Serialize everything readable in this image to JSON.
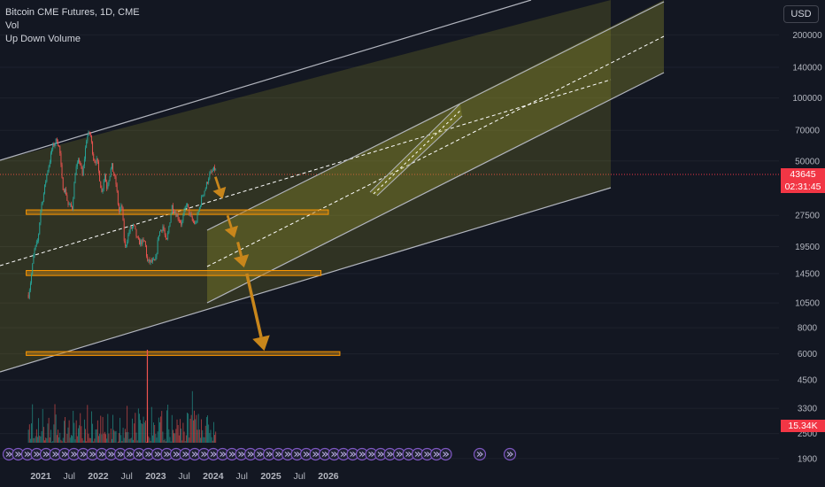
{
  "legend": {
    "symbol": "Bitcoin CME Futures, 1D, CME",
    "vol": "Vol",
    "indicator": "Up Down Volume"
  },
  "currency_button": "USD",
  "last_price": "43645",
  "countdown": "02:31:45",
  "volume_value": "15.34K",
  "colors": {
    "background": "#131722",
    "up": "#26a69a",
    "down": "#ef5350",
    "channel_fill": "#9c9c2a",
    "zone_fill": "#b57a1a",
    "zone_border": "#ff9800",
    "arrow": "#c8861b",
    "event_icon": "#7e57c2"
  },
  "chart_data": {
    "type": "candlestick",
    "title": "Bitcoin CME Futures, 1D, CME",
    "y_scale": "log",
    "y_ticks": [
      200000,
      140000,
      100000,
      70000,
      50000,
      27500,
      19500,
      14500,
      10500,
      8000,
      6000,
      4500,
      3300,
      2500,
      1900
    ],
    "y_tick_labels": [
      "200000",
      "140000",
      "100000",
      "70000",
      "50000",
      "27500",
      "19500",
      "14500",
      "10500",
      "8000",
      "6000",
      "4500",
      "3300",
      "2500",
      "1900"
    ],
    "x_ticks": [
      "2021",
      "Jul",
      "2022",
      "Jul",
      "2023",
      "Jul",
      "2024",
      "Jul",
      "2025",
      "Jul",
      "2026"
    ],
    "price_path": [
      [
        "2020-10-15",
        11500
      ],
      [
        "2020-11-01",
        13800
      ],
      [
        "2020-11-20",
        18500
      ],
      [
        "2020-12-15",
        21000
      ],
      [
        "2021-01-01",
        29500
      ],
      [
        "2021-01-20",
        35000
      ],
      [
        "2021-02-10",
        44000
      ],
      [
        "2021-02-25",
        49000
      ],
      [
        "2021-03-15",
        58000
      ],
      [
        "2021-04-14",
        63500
      ],
      [
        "2021-05-01",
        57000
      ],
      [
        "2021-05-19",
        38000
      ],
      [
        "2021-06-10",
        35500
      ],
      [
        "2021-06-22",
        31000
      ],
      [
        "2021-07-20",
        30000
      ],
      [
        "2021-08-10",
        45500
      ],
      [
        "2021-09-05",
        51000
      ],
      [
        "2021-09-22",
        42000
      ],
      [
        "2021-10-20",
        65000
      ],
      [
        "2021-11-10",
        68500
      ],
      [
        "2021-12-04",
        50500
      ],
      [
        "2021-12-25",
        50000
      ],
      [
        "2022-01-10",
        41500
      ],
      [
        "2022-01-24",
        35000
      ],
      [
        "2022-02-10",
        44000
      ],
      [
        "2022-02-24",
        37500
      ],
      [
        "2022-03-28",
        47500
      ],
      [
        "2022-04-25",
        38500
      ],
      [
        "2022-05-12",
        28500
      ],
      [
        "2022-06-01",
        30500
      ],
      [
        "2022-06-18",
        19000
      ],
      [
        "2022-07-20",
        23500
      ],
      [
        "2022-08-15",
        24500
      ],
      [
        "2022-09-10",
        20500
      ],
      [
        "2022-10-25",
        20500
      ],
      [
        "2022-11-09",
        16500
      ],
      [
        "2022-12-30",
        16500
      ],
      [
        "2023-01-20",
        22500
      ],
      [
        "2023-02-16",
        24500
      ],
      [
        "2023-03-10",
        20000
      ],
      [
        "2023-04-14",
        30500
      ],
      [
        "2023-06-15",
        25000
      ],
      [
        "2023-07-14",
        31500
      ],
      [
        "2023-08-18",
        26000
      ],
      [
        "2023-09-11",
        25000
      ],
      [
        "2023-10-25",
        34500
      ],
      [
        "2023-11-15",
        37500
      ],
      [
        "2023-12-05",
        42500
      ],
      [
        "2024-01-11",
        46000
      ],
      [
        "2024-01-22",
        43645
      ]
    ],
    "last_price": 43645,
    "horizontal_zones": [
      {
        "from": "2020-10-01",
        "to": "2026-01-01",
        "low": 27800,
        "high": 29200
      },
      {
        "from": "2020-10-01",
        "to": "2025-11-15",
        "low": 14200,
        "high": 15000
      },
      {
        "from": "2020-10-01",
        "to": "2026-03-15",
        "low": 5900,
        "high": 6150
      }
    ],
    "projected_arrows": [
      {
        "from": [
          "2024-01-15",
          42000
        ],
        "to": [
          "2024-03-01",
          33000
        ]
      },
      {
        "from": [
          "2024-04-01",
          27500
        ],
        "to": [
          "2024-05-15",
          21500
        ]
      },
      {
        "from": [
          "2024-06-05",
          20500
        ],
        "to": [
          "2024-07-15",
          15500
        ]
      },
      {
        "from": [
          "2024-08-01",
          14500
        ],
        "to": [
          "2024-11-20",
          6200
        ]
      }
    ]
  }
}
